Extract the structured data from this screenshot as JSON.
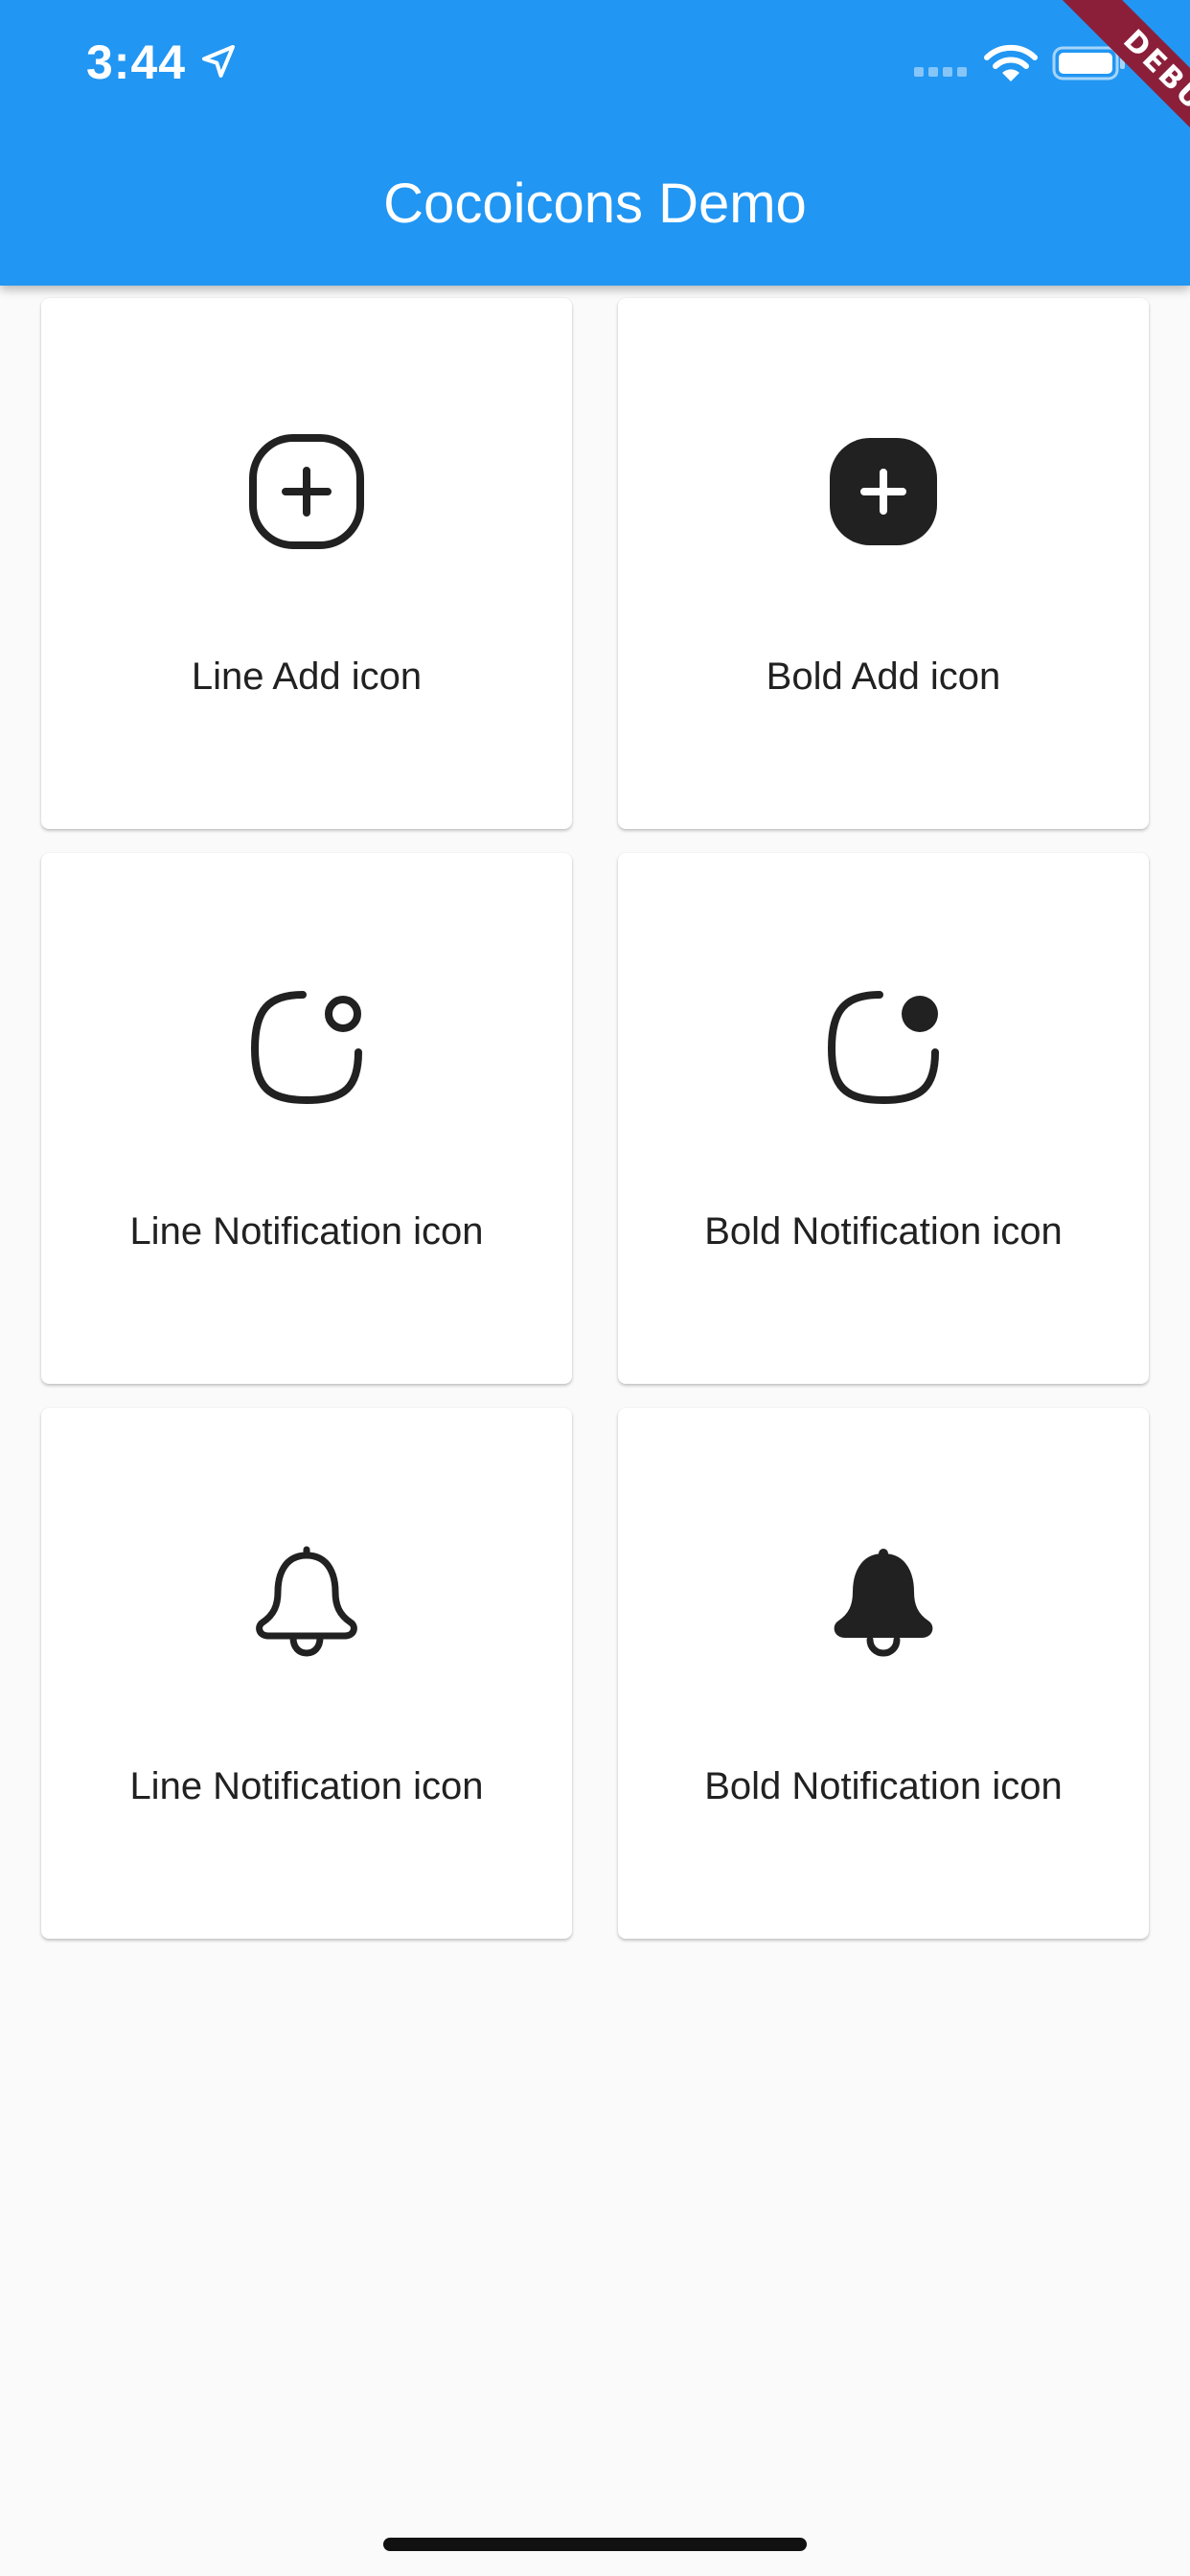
{
  "status_bar": {
    "time": "3:44"
  },
  "app_bar": {
    "title": "Cocoicons Demo"
  },
  "debug_banner": "DEBUG",
  "cards": [
    {
      "label": "Line Add icon",
      "icon": "add-line-icon"
    },
    {
      "label": "Bold Add icon",
      "icon": "add-bold-icon"
    },
    {
      "label": "Line Notification icon",
      "icon": "notification-line-icon"
    },
    {
      "label": "Bold Notification icon",
      "icon": "notification-bold-icon"
    },
    {
      "label": "Line Notification icon",
      "icon": "bell-line-icon"
    },
    {
      "label": "Bold Notification icon",
      "icon": "bell-bold-icon"
    }
  ],
  "colors": {
    "app_bar": "#2196f3",
    "icon": "#212121",
    "background": "#fafafa",
    "debug": "#8b1f3a"
  }
}
